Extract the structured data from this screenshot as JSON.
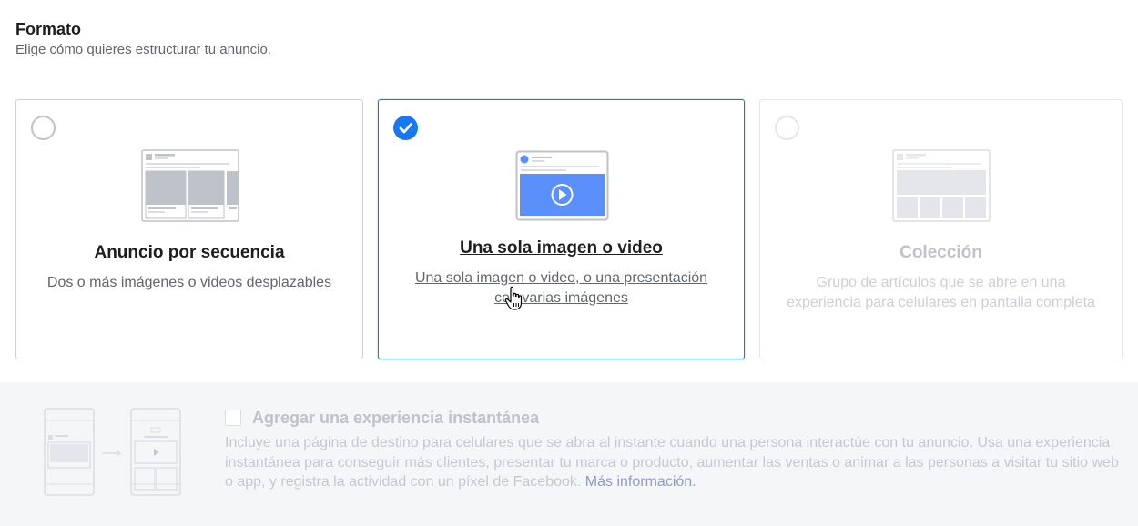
{
  "header": {
    "title": "Formato",
    "subtitle": "Elige cómo quieres estructurar tu anuncio."
  },
  "cards": [
    {
      "title": "Anuncio por secuencia",
      "description": "Dos o más imágenes o videos desplazables",
      "selected": false,
      "enabled": true,
      "icon": "carousel-icon"
    },
    {
      "title": "Una sola imagen o video",
      "description": "Una sola imagen o video, o una presentación con varias imágenes",
      "selected": true,
      "enabled": true,
      "icon": "single-video-icon"
    },
    {
      "title": "Colección",
      "description": "Grupo de artículos que se abre en una experiencia para celulares en pantalla completa",
      "selected": false,
      "enabled": false,
      "icon": "collection-icon"
    }
  ],
  "instant_experience": {
    "title": "Agregar una experiencia instantánea",
    "checked": false,
    "description": "Incluye una página de destino para celulares que se abra al instante cuando una persona interactúe con tu anuncio. Usa una experiencia instantánea para conseguir más clientes, presentar tu marca o producto, aumentar las ventas o animar a las personas a visitar tu sitio web o app, y registra la actividad con un píxel de Facebook.",
    "link_label": "Más información."
  },
  "colors": {
    "accent": "#1877f2",
    "video_fill": "#5b8ff9",
    "border": "#ccd0d5"
  }
}
